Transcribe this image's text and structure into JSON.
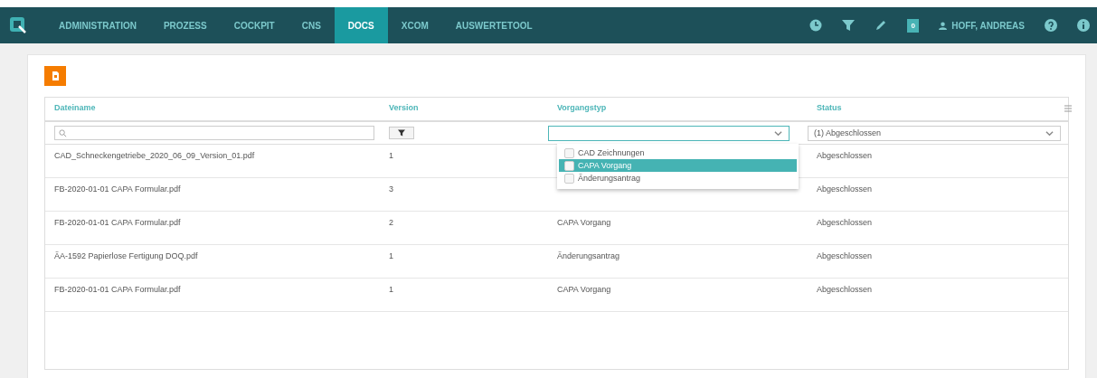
{
  "nav": {
    "items": [
      {
        "label": "ADMINISTRATION",
        "selected": false
      },
      {
        "label": "PROZESS",
        "selected": false
      },
      {
        "label": "COCKPIT",
        "selected": false
      },
      {
        "label": "CNS",
        "selected": false
      },
      {
        "label": "DOCS",
        "selected": true
      },
      {
        "label": "XCOM",
        "selected": false
      },
      {
        "label": "AUSWERTETOOL",
        "selected": false
      }
    ],
    "badge": "0",
    "user": "HOFF, ANDREAS"
  },
  "table": {
    "columns": [
      "Dateiname",
      "Version",
      "Vorgangstyp",
      "Status"
    ],
    "status_filter": "(1) Abgeschlossen",
    "type_options": [
      {
        "label": "CAD Zeichnungen",
        "selected": false,
        "checked": false
      },
      {
        "label": "CAPA Vorgang",
        "selected": true,
        "checked": false
      },
      {
        "label": "Änderungsantrag",
        "selected": false,
        "checked": false
      }
    ],
    "rows": [
      {
        "file": "CAD_Schneckengetriebe_2020_06_09_Version_01.pdf",
        "version": "1",
        "type": "",
        "status": "Abgeschlossen"
      },
      {
        "file": "FB-2020-01-01 CAPA Formular.pdf",
        "version": "3",
        "type": "",
        "status": "Abgeschlossen"
      },
      {
        "file": "FB-2020-01-01 CAPA Formular.pdf",
        "version": "2",
        "type": "CAPA Vorgang",
        "status": "Abgeschlossen"
      },
      {
        "file": "ÄA-1592 Papierlose Fertigung DOQ.pdf",
        "version": "1",
        "type": "Änderungsantrag",
        "status": "Abgeschlossen"
      },
      {
        "file": "FB-2020-01-01 CAPA Formular.pdf",
        "version": "1",
        "type": "CAPA Vorgang",
        "status": "Abgeschlossen"
      }
    ]
  }
}
